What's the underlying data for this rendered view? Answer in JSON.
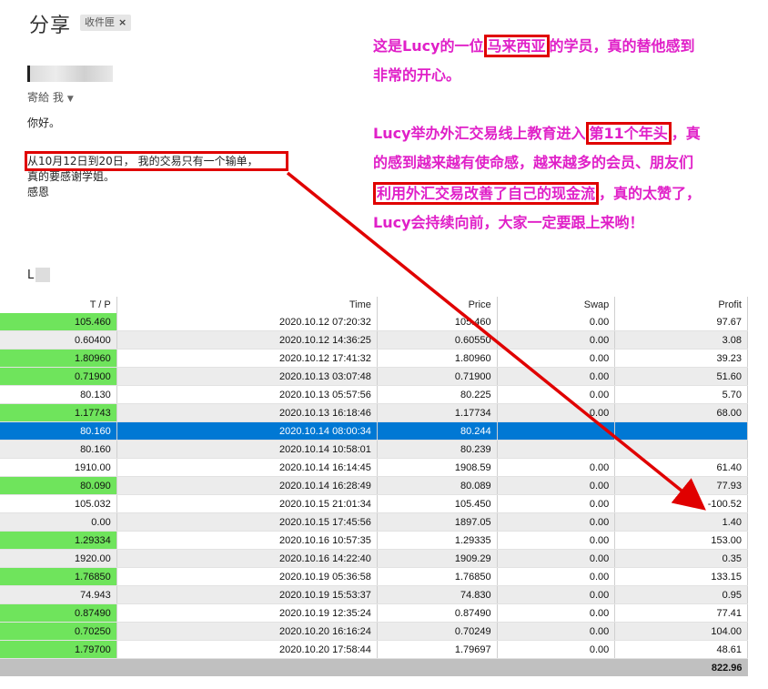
{
  "email": {
    "subject": "分享",
    "label": "收件匣",
    "sender_initial": "L",
    "to_line": "寄給 我",
    "greeting": "你好。",
    "line1": "从10月12日到20日， 我的交易只有一个输单，",
    "line2": "真的要感谢学姐。",
    "line3": "感恩",
    "signature_initial": "L"
  },
  "annotation": {
    "p1_a": "这是Lucy的一位",
    "p1_box": "马来西亚",
    "p1_b": "的学员，真的替他感到",
    "p1_c": "非常的开心。",
    "p2_a": "Lucy举办外汇交易线上教育进入",
    "p2_box1": "第11个年头",
    "p2_b": "，真",
    "p2_c": "的感到越来越有使命感，越来越多的会员、朋友们",
    "p2_box2": "利用外汇交易改善了自己的现金流",
    "p2_d": "，真的太赞了，",
    "p2_e": "Lucy会持续向前，大家一定要跟上来哟！",
    "color": "#e020c8",
    "box_color": "#e00000"
  },
  "table": {
    "headers": [
      "T / P",
      "Time",
      "Price",
      "Swap",
      "Profit"
    ],
    "rows": [
      {
        "tp": "105.460",
        "time": "2020.10.12 07:20:32",
        "price": "105.460",
        "swap": "0.00",
        "profit": "97.67",
        "green": true
      },
      {
        "tp": "0.60400",
        "time": "2020.10.12 14:36:25",
        "price": "0.60550",
        "swap": "0.00",
        "profit": "3.08",
        "green": false
      },
      {
        "tp": "1.80960",
        "time": "2020.10.12 17:41:32",
        "price": "1.80960",
        "swap": "0.00",
        "profit": "39.23",
        "green": true
      },
      {
        "tp": "0.71900",
        "time": "2020.10.13 03:07:48",
        "price": "0.71900",
        "swap": "0.00",
        "profit": "51.60",
        "green": true
      },
      {
        "tp": "80.130",
        "time": "2020.10.13 05:57:56",
        "price": "80.225",
        "swap": "0.00",
        "profit": "5.70",
        "green": false
      },
      {
        "tp": "1.17743",
        "time": "2020.10.13 16:18:46",
        "price": "1.17734",
        "swap": "0.00",
        "profit": "68.00",
        "green": true
      },
      {
        "tp": "80.160",
        "time": "2020.10.14 08:00:34",
        "price": "80.244",
        "swap": "",
        "profit": "",
        "green": false,
        "selected": true
      },
      {
        "tp": "80.160",
        "time": "2020.10.14 10:58:01",
        "price": "80.239",
        "swap": "",
        "profit": "",
        "green": false
      },
      {
        "tp": "1910.00",
        "time": "2020.10.14 16:14:45",
        "price": "1908.59",
        "swap": "0.00",
        "profit": "61.40",
        "green": false
      },
      {
        "tp": "80.090",
        "time": "2020.10.14 16:28:49",
        "price": "80.089",
        "swap": "0.00",
        "profit": "77.93",
        "green": true
      },
      {
        "tp": "105.032",
        "time": "2020.10.15 21:01:34",
        "price": "105.450",
        "swap": "0.00",
        "profit": "-100.52",
        "green": false
      },
      {
        "tp": "0.00",
        "time": "2020.10.15 17:45:56",
        "price": "1897.05",
        "swap": "0.00",
        "profit": "1.40",
        "green": false
      },
      {
        "tp": "1.29334",
        "time": "2020.10.16 10:57:35",
        "price": "1.29335",
        "swap": "0.00",
        "profit": "153.00",
        "green": true
      },
      {
        "tp": "1920.00",
        "time": "2020.10.16 14:22:40",
        "price": "1909.29",
        "swap": "0.00",
        "profit": "0.35",
        "green": false
      },
      {
        "tp": "1.76850",
        "time": "2020.10.19 05:36:58",
        "price": "1.76850",
        "swap": "0.00",
        "profit": "133.15",
        "green": true
      },
      {
        "tp": "74.943",
        "time": "2020.10.19 15:53:37",
        "price": "74.830",
        "swap": "0.00",
        "profit": "0.95",
        "green": false
      },
      {
        "tp": "0.87490",
        "time": "2020.10.19 12:35:24",
        "price": "0.87490",
        "swap": "0.00",
        "profit": "77.41",
        "green": true
      },
      {
        "tp": "0.70250",
        "time": "2020.10.20 16:16:24",
        "price": "0.70249",
        "swap": "0.00",
        "profit": "104.00",
        "green": true
      },
      {
        "tp": "1.79700",
        "time": "2020.10.20 17:58:44",
        "price": "1.79697",
        "swap": "0.00",
        "profit": "48.61",
        "green": true
      }
    ],
    "total": "822.96",
    "green_color": "#6fe45c",
    "selected_color": "#0078d4"
  }
}
